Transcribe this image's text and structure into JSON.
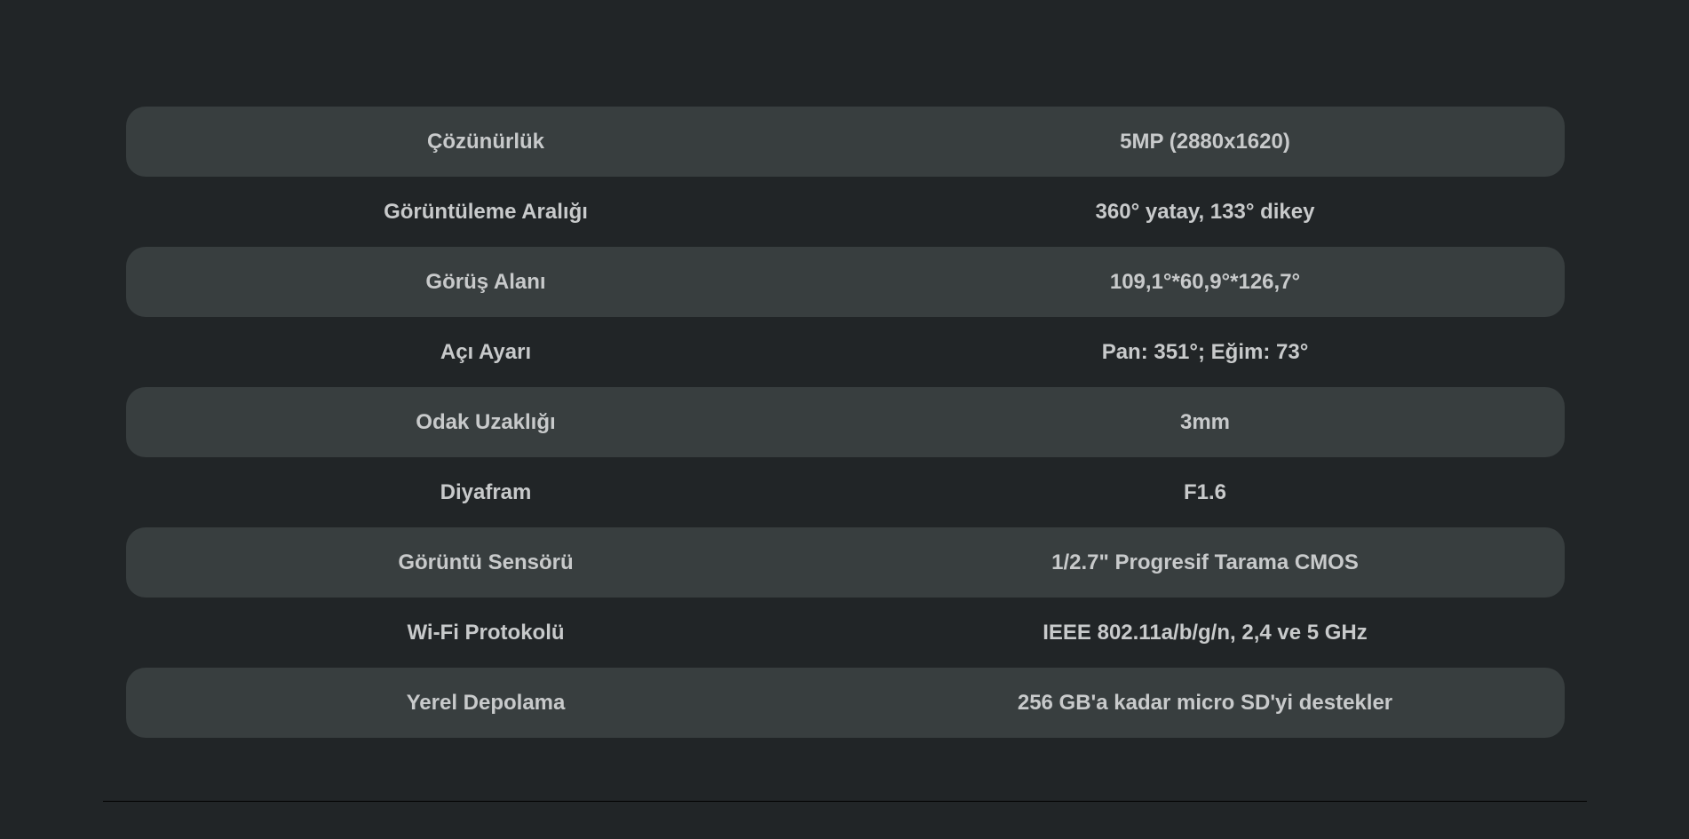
{
  "specs": [
    {
      "label": "Çözünürlük",
      "value": "5MP (2880x1620)"
    },
    {
      "label": "Görüntüleme Aralığı",
      "value": "360° yatay, 133° dikey"
    },
    {
      "label": "Görüş Alanı",
      "value": "109,1°*60,9°*126,7°"
    },
    {
      "label": "Açı Ayarı",
      "value": "Pan: 351°; Eğim: 73°"
    },
    {
      "label": "Odak Uzaklığı",
      "value": "3mm"
    },
    {
      "label": "Diyafram",
      "value": "F1.6"
    },
    {
      "label": "Görüntü Sensörü",
      "value": "1/2.7\" Progresif Tarama CMOS"
    },
    {
      "label": "Wi-Fi Protokolü",
      "value": "IEEE 802.11a/b/g/n, 2,4 ve 5 GHz"
    },
    {
      "label": "Yerel Depolama",
      "value": "256 GB'a kadar micro SD'yi destekler"
    }
  ],
  "colors": {
    "background": "#212527",
    "row_shade": "#383e3f",
    "text": "#c8cacb"
  }
}
